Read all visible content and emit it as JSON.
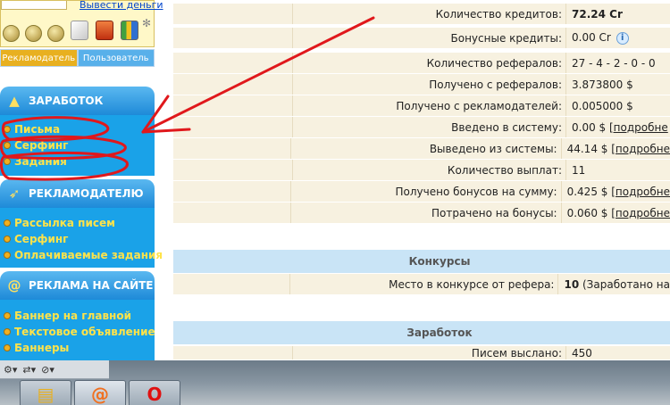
{
  "header": {
    "withdraw_link": "Вывести деньги"
  },
  "role_tabs": {
    "advertiser": "Рекламодатель",
    "user": "Пользователь"
  },
  "sidebar": {
    "earnings": {
      "title": "ЗАРАБОТОК",
      "items": [
        "Письма",
        "Серфинг",
        "Задания"
      ]
    },
    "advertiser": {
      "title": "РЕКЛАМОДАТЕЛЮ",
      "items": [
        "Рассылка писем",
        "Серфинг",
        "Оплачиваемые задания"
      ]
    },
    "site_ads": {
      "title": "РЕКЛАМА НА САЙТЕ",
      "items": [
        "Баннер на главной",
        "Текстовое объявление",
        "Баннеры"
      ]
    }
  },
  "stats": {
    "rows": [
      {
        "label": "Количество кредитов:",
        "value": "72.24 Cr"
      },
      {
        "label": "Бонусные кредиты:",
        "value": "0.00 Cr"
      },
      {
        "label": "Количество рефералов:",
        "value": "27 - 4 - 2 - 0 - 0"
      },
      {
        "label": "Получено с рефералов:",
        "value": "3.873800 $"
      },
      {
        "label": "Получено с рекламодателей:",
        "value": "0.005000 $"
      },
      {
        "label": "Введено в систему:",
        "value": "0.00 $",
        "link": "[подробне"
      },
      {
        "label": "Выведено из системы:",
        "value": "44.14 $",
        "link": "[подробне"
      },
      {
        "label": "Количество выплат:",
        "value": "11"
      },
      {
        "label": "Получено бонусов на сумму:",
        "value": "0.425 $",
        "link": "[подробне"
      },
      {
        "label": "Потрачено на бонусы:",
        "value": "0.060 $",
        "link": "[подробне"
      }
    ]
  },
  "contests": {
    "title": "Конкурсы",
    "row_label": "Место в конкурсе от рефера:",
    "row_value": "10",
    "row_note": "(Заработано на"
  },
  "earnings_block": {
    "title": "Заработок",
    "row_label": "Писем выслано:",
    "row_value": "450"
  },
  "colors": {
    "sidebar_blue": "#1aa2e8",
    "sidebar_item": "#ffe34a",
    "row_bg": "#f7f1e0",
    "block_head": "#c9e4f6",
    "annotation_red": "#e0181c"
  }
}
